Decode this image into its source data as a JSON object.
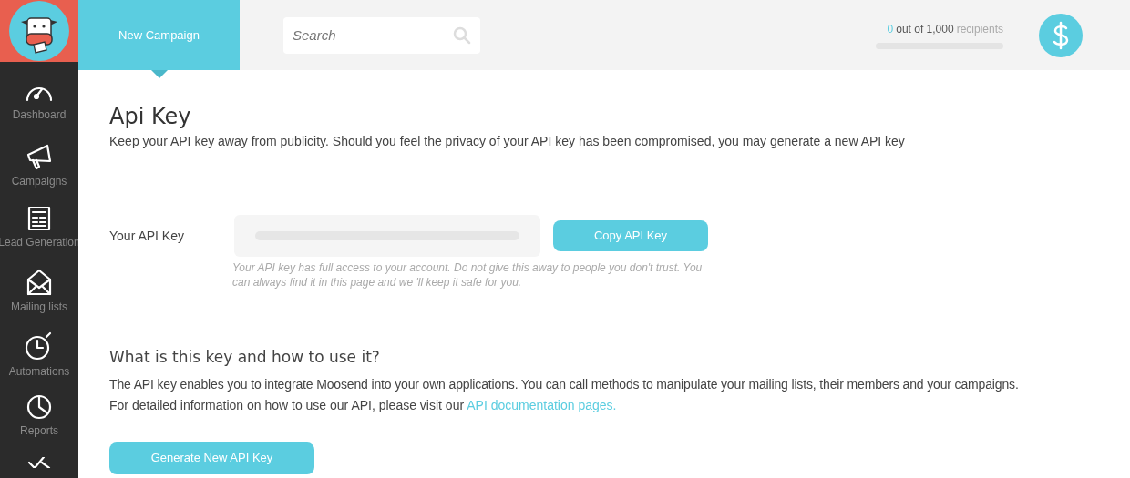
{
  "header": {
    "new_campaign": "New Campaign",
    "search": {
      "placeholder": "Search"
    },
    "recipients": {
      "count": "0",
      "limit": "out of 1,000",
      "unit": "recipients",
      "level": 0
    }
  },
  "sidebar": {
    "items": [
      {
        "kind": "dashboard",
        "label": "Dashboard"
      },
      {
        "kind": "campaigns",
        "label": "Campaigns"
      },
      {
        "kind": "lead",
        "label": "Lead Generation"
      },
      {
        "kind": "mail",
        "label": "Mailing lists"
      },
      {
        "kind": "automation",
        "label": "Automations"
      },
      {
        "kind": "reports",
        "label": "Reports"
      },
      {
        "kind": "check"
      }
    ]
  },
  "page": {
    "title": "Api Key",
    "subtitle": "Keep your API key away from publicity. Should you feel the privacy of your API key has been compromised, you may generate a new API key",
    "key_label": "Your API Key",
    "copy_button": "Copy API Key",
    "hint": "Your API key has full access to your account. Do not give this away to people you don't trust. You can always find it in this page and we 'll keep it safe for you.",
    "section_title": "What is this key and how to use it?",
    "line_1": "The API key enables you to integrate Moosend into your own applications. You can call methods to manipulate your mailing lists, their members and your campaigns.",
    "line_2": "For detailed information on how to use our API, please visit our",
    "link": "API documentation pages.",
    "generate_button": "Generate New API Key"
  }
}
